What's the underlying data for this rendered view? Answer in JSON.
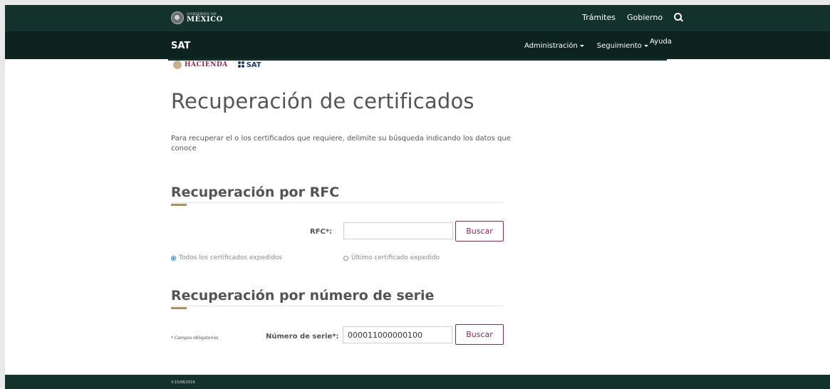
{
  "topbar": {
    "gov_small": "GOBIERNO DE",
    "gov_big": "MÉXICO",
    "links": [
      "Trámites",
      "Gobierno"
    ],
    "search_icon": "search-icon"
  },
  "navbar": {
    "brand": "SAT",
    "menu": [
      {
        "label": "Administración"
      },
      {
        "label": "Seguimiento"
      }
    ],
    "help": "Ayuda"
  },
  "logos": {
    "hacienda": "HACIENDA",
    "sat": "SAT"
  },
  "page": {
    "title": "Recuperación de certificados",
    "intro": "Para recuperar el o los certificados que requiere, delimite su búsqueda indicando los datos que conoce"
  },
  "rfc_section": {
    "title": "Recuperación por RFC",
    "label": "RFC*:",
    "value": "",
    "button": "Buscar",
    "options": [
      {
        "label": "Todos los certificados expedidos",
        "checked": true
      },
      {
        "label": "Último certificado expedido",
        "checked": false
      }
    ]
  },
  "serie_section": {
    "title": "Recuperación por número de serie",
    "required_note": "* Campos obligatorios",
    "label": "Número de serie*:",
    "value": "000011000000100",
    "button": "Buscar"
  },
  "footer": {
    "version": "V-15/08/2016"
  },
  "colors": {
    "header_green": "#13322b",
    "nav_green": "#0c231e",
    "accent_gold": "#b38e5d",
    "button_red": "#9d2449",
    "radio_blue": "#1e88e5"
  }
}
